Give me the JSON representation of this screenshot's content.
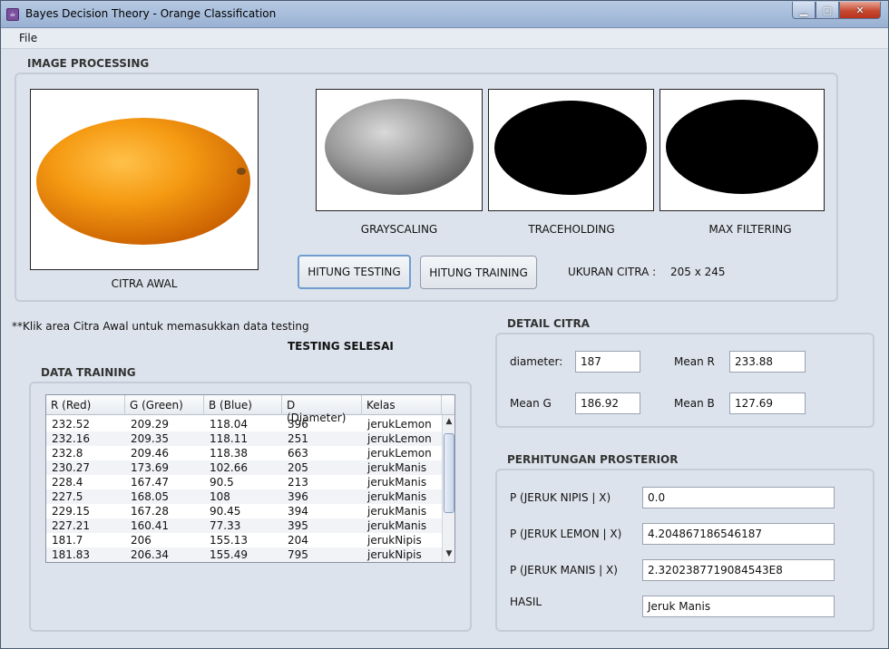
{
  "window": {
    "title": "Bayes Decision Theory - Orange Classification"
  },
  "menu": {
    "file": "File"
  },
  "image_processing": {
    "label": "IMAGE PROCESSING",
    "captions": {
      "original": "CITRA AWAL",
      "grayscaling": "GRAYSCALING",
      "traceholding": "TRACEHOLDING",
      "max_filtering": "MAX FILTERING"
    },
    "buttons": {
      "testing": "HITUNG TESTING",
      "training": "HITUNG TRAINING"
    },
    "size_label": "UKURAN CITRA :",
    "size_value": "205 x 245",
    "colors": {
      "orange": "#f08a10",
      "gray": "#8a8a8a",
      "mask": "#000000"
    }
  },
  "hint": "**Klik area Citra Awal untuk memasukkan data testing",
  "status": "TESTING SELESAI",
  "data_training": {
    "label": "DATA TRAINING",
    "columns": [
      "R (Red)",
      "G (Green)",
      "B (Blue)",
      "D (Diameter)",
      "Kelas"
    ],
    "rows": [
      [
        "232.52",
        "209.29",
        "118.04",
        "396",
        "jerukLemon"
      ],
      [
        "232.16",
        "209.35",
        "118.11",
        "251",
        "jerukLemon"
      ],
      [
        "232.8",
        "209.46",
        "118.38",
        "663",
        "jerukLemon"
      ],
      [
        "230.27",
        "173.69",
        "102.66",
        "205",
        "jerukManis"
      ],
      [
        "228.4",
        "167.47",
        "90.5",
        "213",
        "jerukManis"
      ],
      [
        "227.5",
        "168.05",
        "108",
        "396",
        "jerukManis"
      ],
      [
        "229.15",
        "167.28",
        "90.45",
        "394",
        "jerukManis"
      ],
      [
        "227.21",
        "160.41",
        "77.33",
        "395",
        "jerukManis"
      ],
      [
        "181.7",
        "206",
        "155.13",
        "204",
        "jerukNipis"
      ],
      [
        "181.83",
        "206.34",
        "155.49",
        "795",
        "jerukNipis"
      ]
    ]
  },
  "detail_citra": {
    "label": "DETAIL CITRA",
    "diameter_label": "diameter:",
    "diameter_value": "187",
    "mean_r_label": "Mean R",
    "mean_r_value": "233.88",
    "mean_g_label": "Mean G",
    "mean_g_value": "186.92",
    "mean_b_label": "Mean B",
    "mean_b_value": "127.69"
  },
  "posterior": {
    "label": "PERHITUNGAN PROSTERIOR",
    "nipis_label": "P (JERUK NIPIS | X)",
    "nipis_value": "0.0",
    "lemon_label": "P (JERUK LEMON | X)",
    "lemon_value": "4.204867186546187",
    "manis_label": "P (JERUK MANIS | X)",
    "manis_value": "2.3202387719084543E8",
    "hasil_label": "HASIL",
    "hasil_value": "Jeruk Manis"
  }
}
